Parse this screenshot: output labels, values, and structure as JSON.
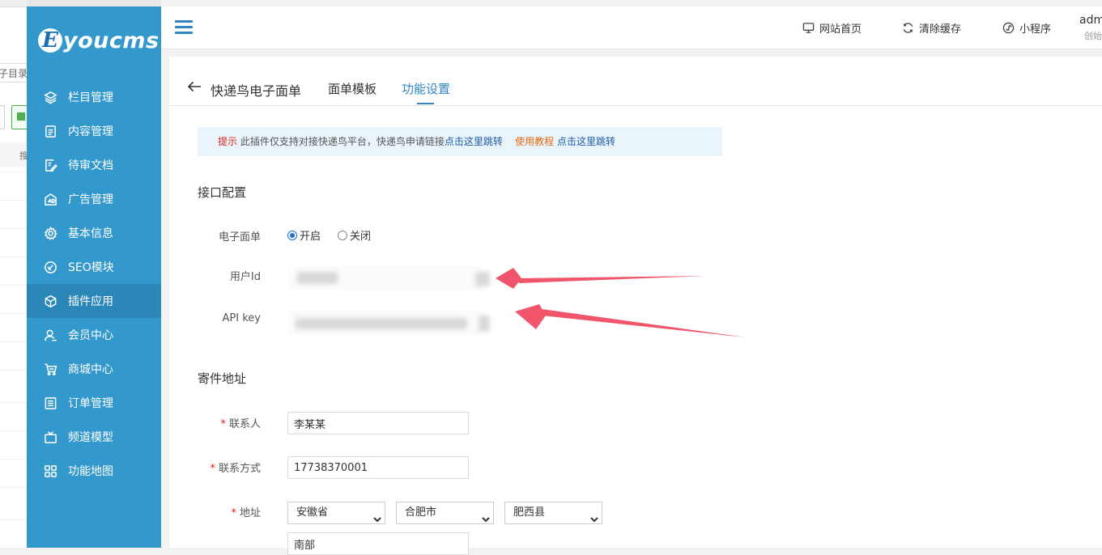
{
  "background_window": {
    "text_fragment": "子目录"
  },
  "sidebar": {
    "logo_letter": "E",
    "logo_text": "youcms",
    "items": [
      {
        "label": "栏目管理",
        "icon": "layers-icon"
      },
      {
        "label": "内容管理",
        "icon": "document-icon"
      },
      {
        "label": "待审文档",
        "icon": "edit-document-icon"
      },
      {
        "label": "广告管理",
        "icon": "ad-icon"
      },
      {
        "label": "基本信息",
        "icon": "gear-icon"
      },
      {
        "label": "SEO模块",
        "icon": "seo-icon"
      },
      {
        "label": "插件应用",
        "icon": "cube-icon",
        "active": true
      },
      {
        "label": "会员中心",
        "icon": "user-icon"
      },
      {
        "label": "商城中心",
        "icon": "cart-icon"
      },
      {
        "label": "订单管理",
        "icon": "list-icon"
      },
      {
        "label": "频道模型",
        "icon": "tv-icon"
      },
      {
        "label": "功能地图",
        "icon": "grid-icon"
      }
    ]
  },
  "header": {
    "links": [
      {
        "label": "网站首页",
        "icon": "monitor-icon"
      },
      {
        "label": "清除缓存",
        "icon": "refresh-icon"
      },
      {
        "label": "小程序",
        "icon": "miniprogram-icon"
      }
    ],
    "user": "adm",
    "user_sub": "创始"
  },
  "tabs": {
    "title": "快递鸟电子面单",
    "items": [
      {
        "label": "面单模板",
        "active": false
      },
      {
        "label": "功能设置",
        "active": true
      }
    ]
  },
  "tip": {
    "prefix": "提示",
    "text": " 此插件仅支持对接快递鸟平台，快递鸟申请链接",
    "link1": "点击这里跳转",
    "tutorial_label": "使用教程",
    "link2": "点击这里跳转"
  },
  "api_section": {
    "title": "接口配置",
    "eorder_label": "电子面单",
    "options": [
      {
        "label": "开启",
        "checked": true
      },
      {
        "label": "关闭",
        "checked": false
      }
    ],
    "user_id_label": "用户Id",
    "api_key_label": "API key"
  },
  "sender_section": {
    "title": "寄件地址",
    "contact_label": "联系人",
    "contact_value": "李某某",
    "phone_label": "联系方式",
    "phone_value": "17738370001",
    "address_label": "地址",
    "province": "安徽省",
    "city": "合肥市",
    "district": "肥西县",
    "detail_value": "南部"
  },
  "colors": {
    "sidebar": "#3398cc",
    "sidebar_active": "#2a87b8",
    "accent": "#2f86c4",
    "arrow": "#f0556b",
    "required": "#e2231a"
  }
}
